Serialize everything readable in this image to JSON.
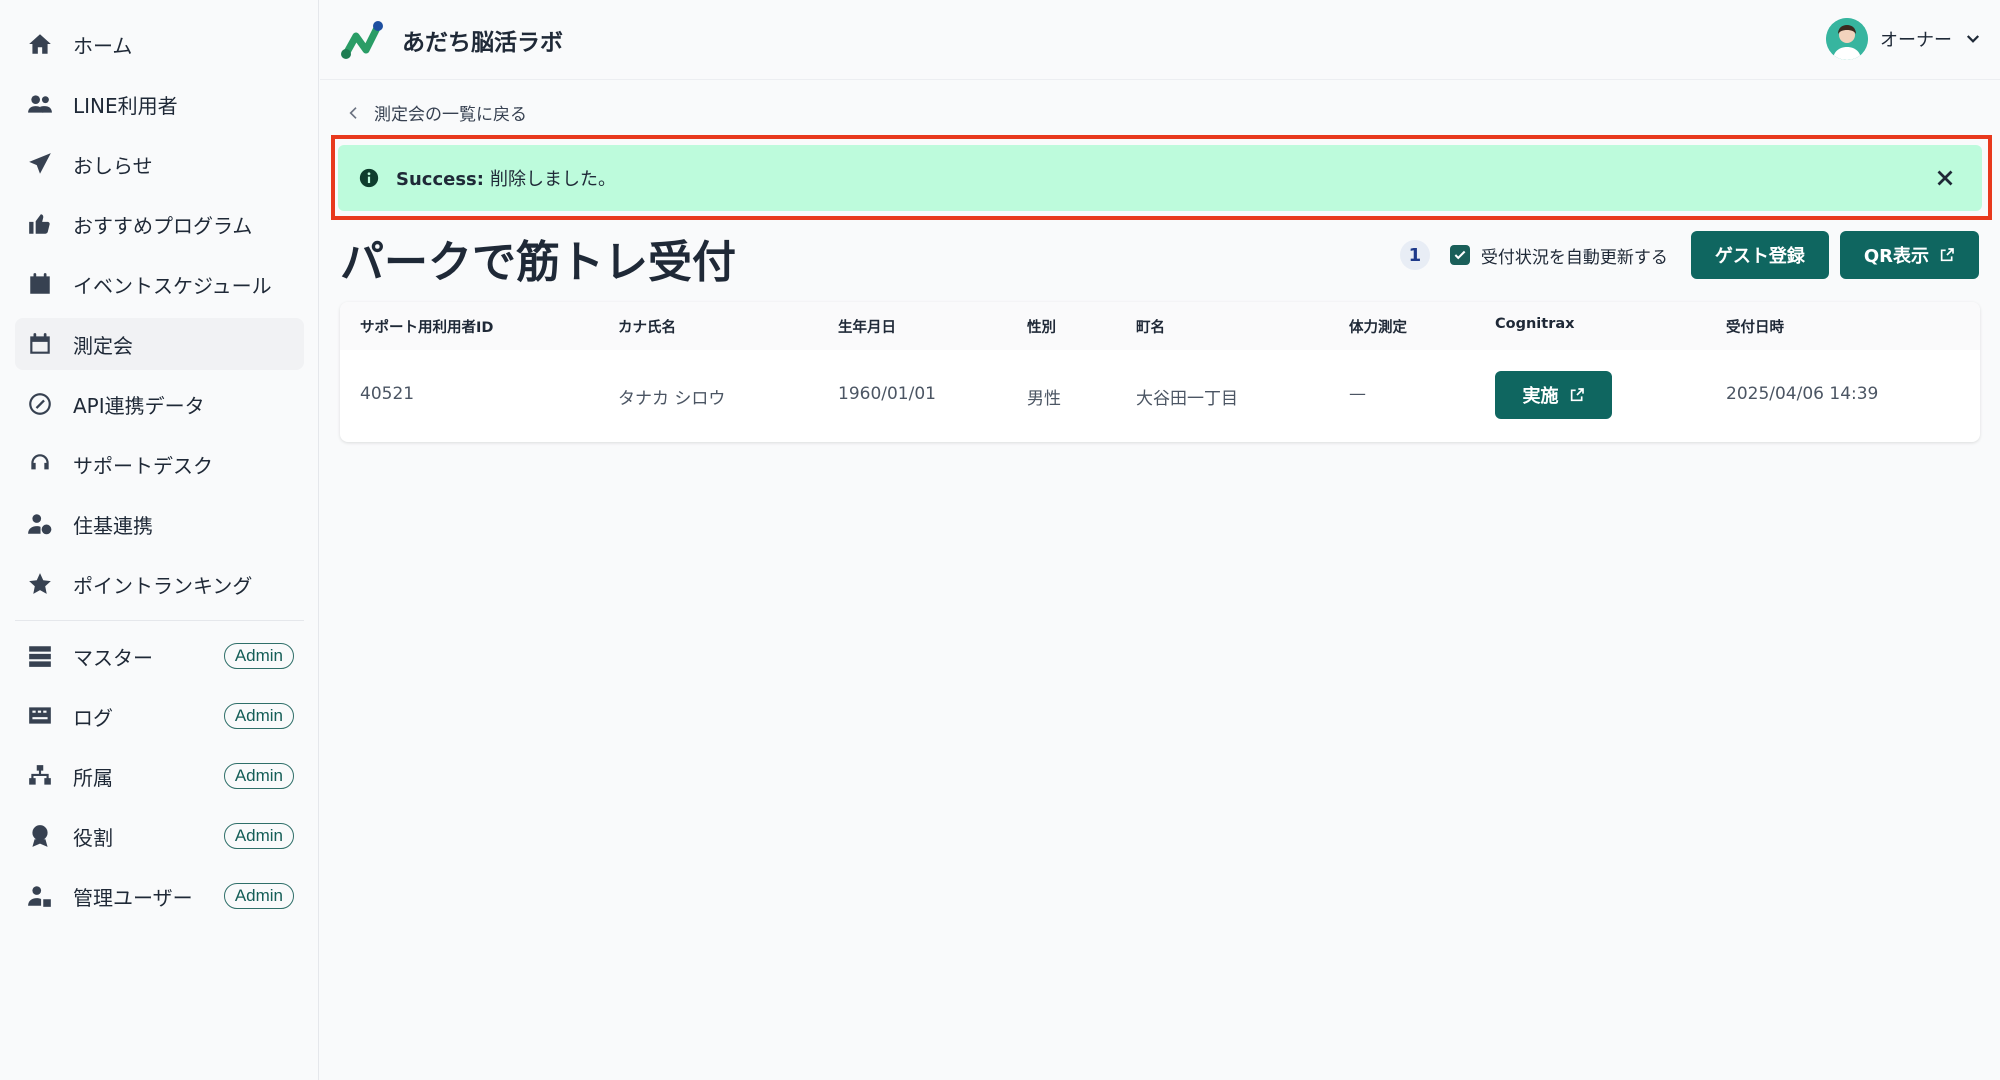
{
  "sidebar": {
    "items": [
      {
        "label": "ホーム",
        "icon": "home-icon"
      },
      {
        "label": "LINE利用者",
        "icon": "users-icon"
      },
      {
        "label": "おしらせ",
        "icon": "paper-plane-icon"
      },
      {
        "label": "おすすめプログラム",
        "icon": "thumbs-up-icon"
      },
      {
        "label": "イベントスケジュール",
        "icon": "calendar-icon"
      },
      {
        "label": "測定会",
        "icon": "calendar-blank-icon",
        "active": true
      },
      {
        "label": "API連携データ",
        "icon": "link-circle-icon"
      },
      {
        "label": "サポートデスク",
        "icon": "headset-icon"
      },
      {
        "label": "住基連携",
        "icon": "user-gear-icon"
      },
      {
        "label": "ポイントランキング",
        "icon": "star-icon"
      }
    ],
    "admin_items": [
      {
        "label": "マスター",
        "icon": "list-icon",
        "badge": "Admin"
      },
      {
        "label": "ログ",
        "icon": "keyboard-icon",
        "badge": "Admin"
      },
      {
        "label": "所属",
        "icon": "sitemap-icon",
        "badge": "Admin"
      },
      {
        "label": "役割",
        "icon": "award-icon",
        "badge": "Admin"
      },
      {
        "label": "管理ユーザー",
        "icon": "user-lock-icon",
        "badge": "Admin"
      }
    ]
  },
  "header": {
    "app_title": "あだち脳活ラボ",
    "user_name": "オーナー"
  },
  "main": {
    "back_link": "測定会の一覧に戻る",
    "alert": {
      "strong": "Success:",
      "message": "削除しました。"
    },
    "title": "パークで筋トレ受付",
    "count": "1",
    "auto_update_label": "受付状況を自動更新する",
    "guest_button": "ゲスト登録",
    "qr_button": "QR表示",
    "table": {
      "columns": [
        "サポート用利用者ID",
        "カナ氏名",
        "生年月日",
        "性別",
        "町名",
        "体力測定",
        "Cognitrax",
        "受付日時"
      ],
      "rows": [
        {
          "id": "40521",
          "kana": "タナカ シロウ",
          "birth": "1960/01/01",
          "gender": "男性",
          "town": "大谷田一丁目",
          "fitness": "—",
          "cognitrax": "実施",
          "received": "2025/04/06 14:39"
        }
      ]
    }
  },
  "colors": {
    "accent": "#0f6660",
    "alert_bg": "#bdfbdc",
    "alert_frame": "#e8391d"
  }
}
